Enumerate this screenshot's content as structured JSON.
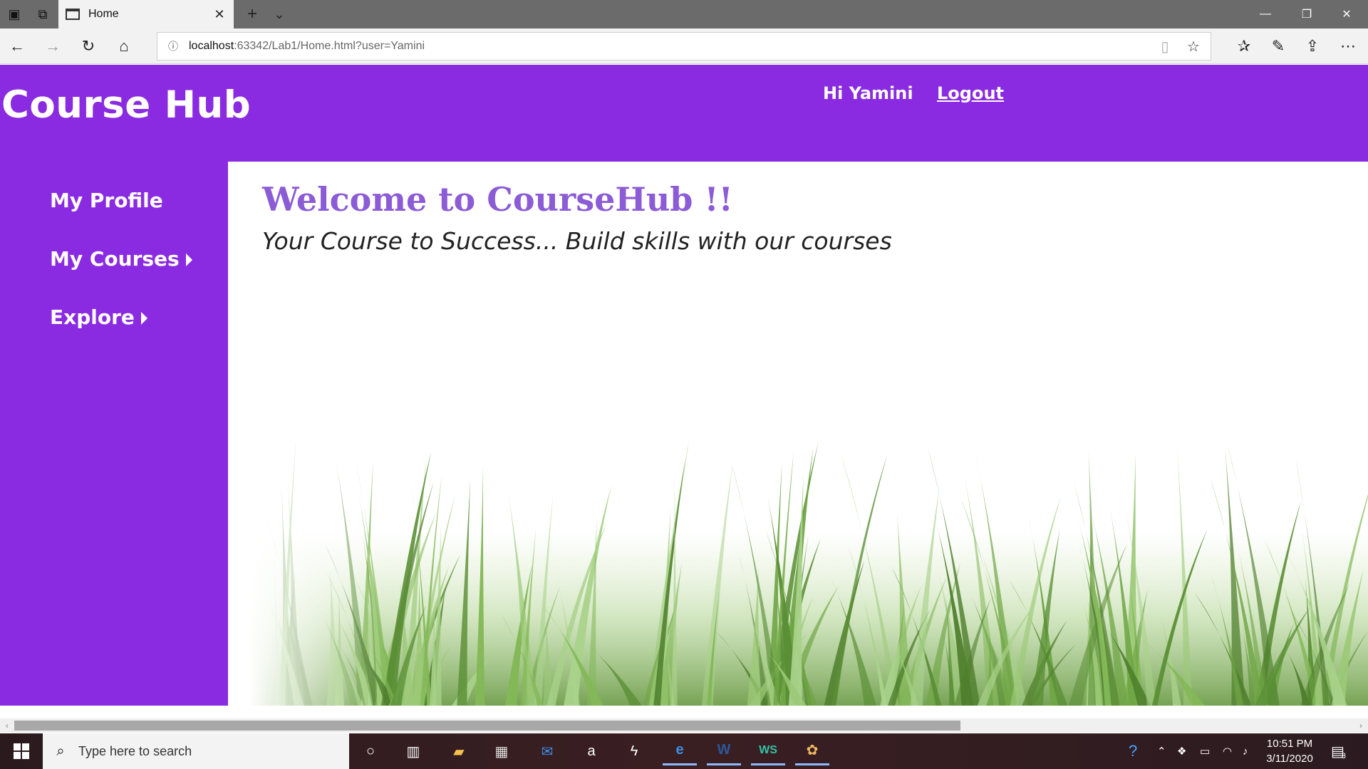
{
  "browser": {
    "tab_title": "Home",
    "url_host": "localhost",
    "url_path": ":63342/Lab1/Home.html?user=Yamini"
  },
  "site": {
    "title": "Course Hub",
    "greeting": "Hi Yamini",
    "logout_label": "Logout",
    "brand_color": "#8a2be2",
    "heading_color": "#8c5bd6"
  },
  "sidebar": {
    "items": [
      {
        "label": "My Profile",
        "has_submenu": false
      },
      {
        "label": "My Courses",
        "has_submenu": true
      },
      {
        "label": "Explore",
        "has_submenu": true
      }
    ]
  },
  "main": {
    "welcome": "Welcome to CourseHub !!",
    "tagline": "Your Course to Success... Build skills with our courses",
    "hero_image": "grass-illustration"
  },
  "taskbar": {
    "search_placeholder": "Type here to search",
    "time": "10:51 PM",
    "date": "3/11/2020",
    "notification_count": "3",
    "apps": [
      "cortana-icon",
      "task-view-icon",
      "file-explorer-icon",
      "store-icon",
      "mail-icon",
      "amazon-icon",
      "app-s-icon",
      "edge-icon",
      "word-icon",
      "webstorm-icon",
      "paint-icon"
    ]
  }
}
